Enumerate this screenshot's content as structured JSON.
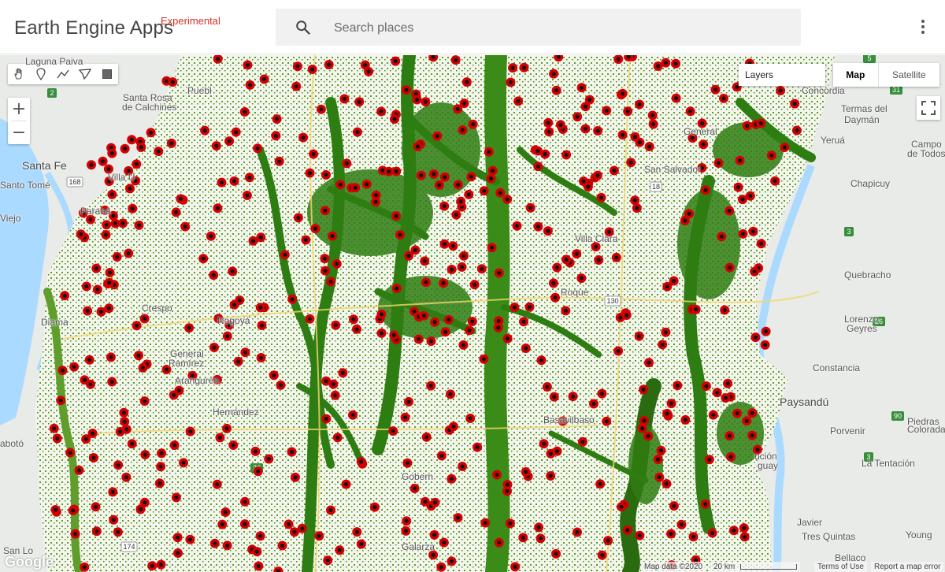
{
  "header": {
    "app_title": "Earth Engine Apps",
    "badge": "Experimental",
    "search_placeholder": "Search places",
    "menu_icon": "more-vert-icon"
  },
  "map": {
    "draw_tools": [
      "hand-pan-icon",
      "point-marker-icon",
      "line-draw-icon",
      "polygon-draw-icon",
      "rectangle-draw-icon"
    ],
    "zoom_in": "+",
    "zoom_out": "−",
    "layers_label": "Layers",
    "map_type": {
      "map": "Map",
      "satellite": "Satellite",
      "selected": "Map"
    },
    "fullscreen_icon": "fullscreen-icon",
    "overlay_colors": {
      "forest": "#2f7d0c",
      "forest_light": "#7cb342",
      "point_fill": "#d50000",
      "point_center": "#111111"
    },
    "place_labels": {
      "laguna_paiva": "Laguna Paiva",
      "santa_rosa": "Santa Rosa",
      "de_calchines": "de Calchines",
      "santa_fe": "Santa Fe",
      "santo_tome": "Santo Tomé",
      "villa_u": "Villa U",
      "viejo": "Viejo",
      "parana": "Paraná",
      "puebl": "Puebl",
      "concordia": "Concordia",
      "termas": "Termas del",
      "dayman": "Daymán",
      "yerua": "Yeruá",
      "campo": "Campo",
      "de_todos": "de Todos",
      "chapicuy": "Chapicuy",
      "san_salvador": "San Salvador",
      "general": "General",
      "villa_clara": "Villa Clara",
      "quebracho": "Quebracho",
      "lorenzo": "Lorenzo",
      "geyres": "Geyres",
      "constancia": "Constancia",
      "paysandu": "Paysandú",
      "porvenir": "Porvenir",
      "piedras": "Piedras",
      "coloradas": "Coloradas",
      "la_tentacion": "La Tentación",
      "javier": "Javier",
      "tres_quintas": "Tres Quintas",
      "bellaco": "Bellaco",
      "young": "Young",
      "general_ramirez": "General",
      "ramirez": "Ramírez",
      "aranguren": "Aranguren",
      "hernandez": "Hernández",
      "diamante": "Diama",
      "crespo": "Crespo",
      "nogoya": "Nogoyá",
      "basavilbaso": "Basavilbaso",
      "san_lo": "San Lo",
      "gobernador": "Gobern",
      "galarza": "Galarza",
      "sauce": "abotó",
      "roque": "Roque",
      "ucion": "ución",
      "guay": "guay"
    },
    "route_badges": [
      "2",
      "31",
      "168",
      "18",
      "130",
      "26",
      "39",
      "90",
      "3",
      "5",
      "11",
      "174",
      "26",
      "32",
      "3"
    ],
    "google_logo": "Google",
    "footer": {
      "map_data": "Map data ©2020",
      "scale": "20 km",
      "terms": "Terms of Use",
      "report": "Report a map error"
    }
  }
}
